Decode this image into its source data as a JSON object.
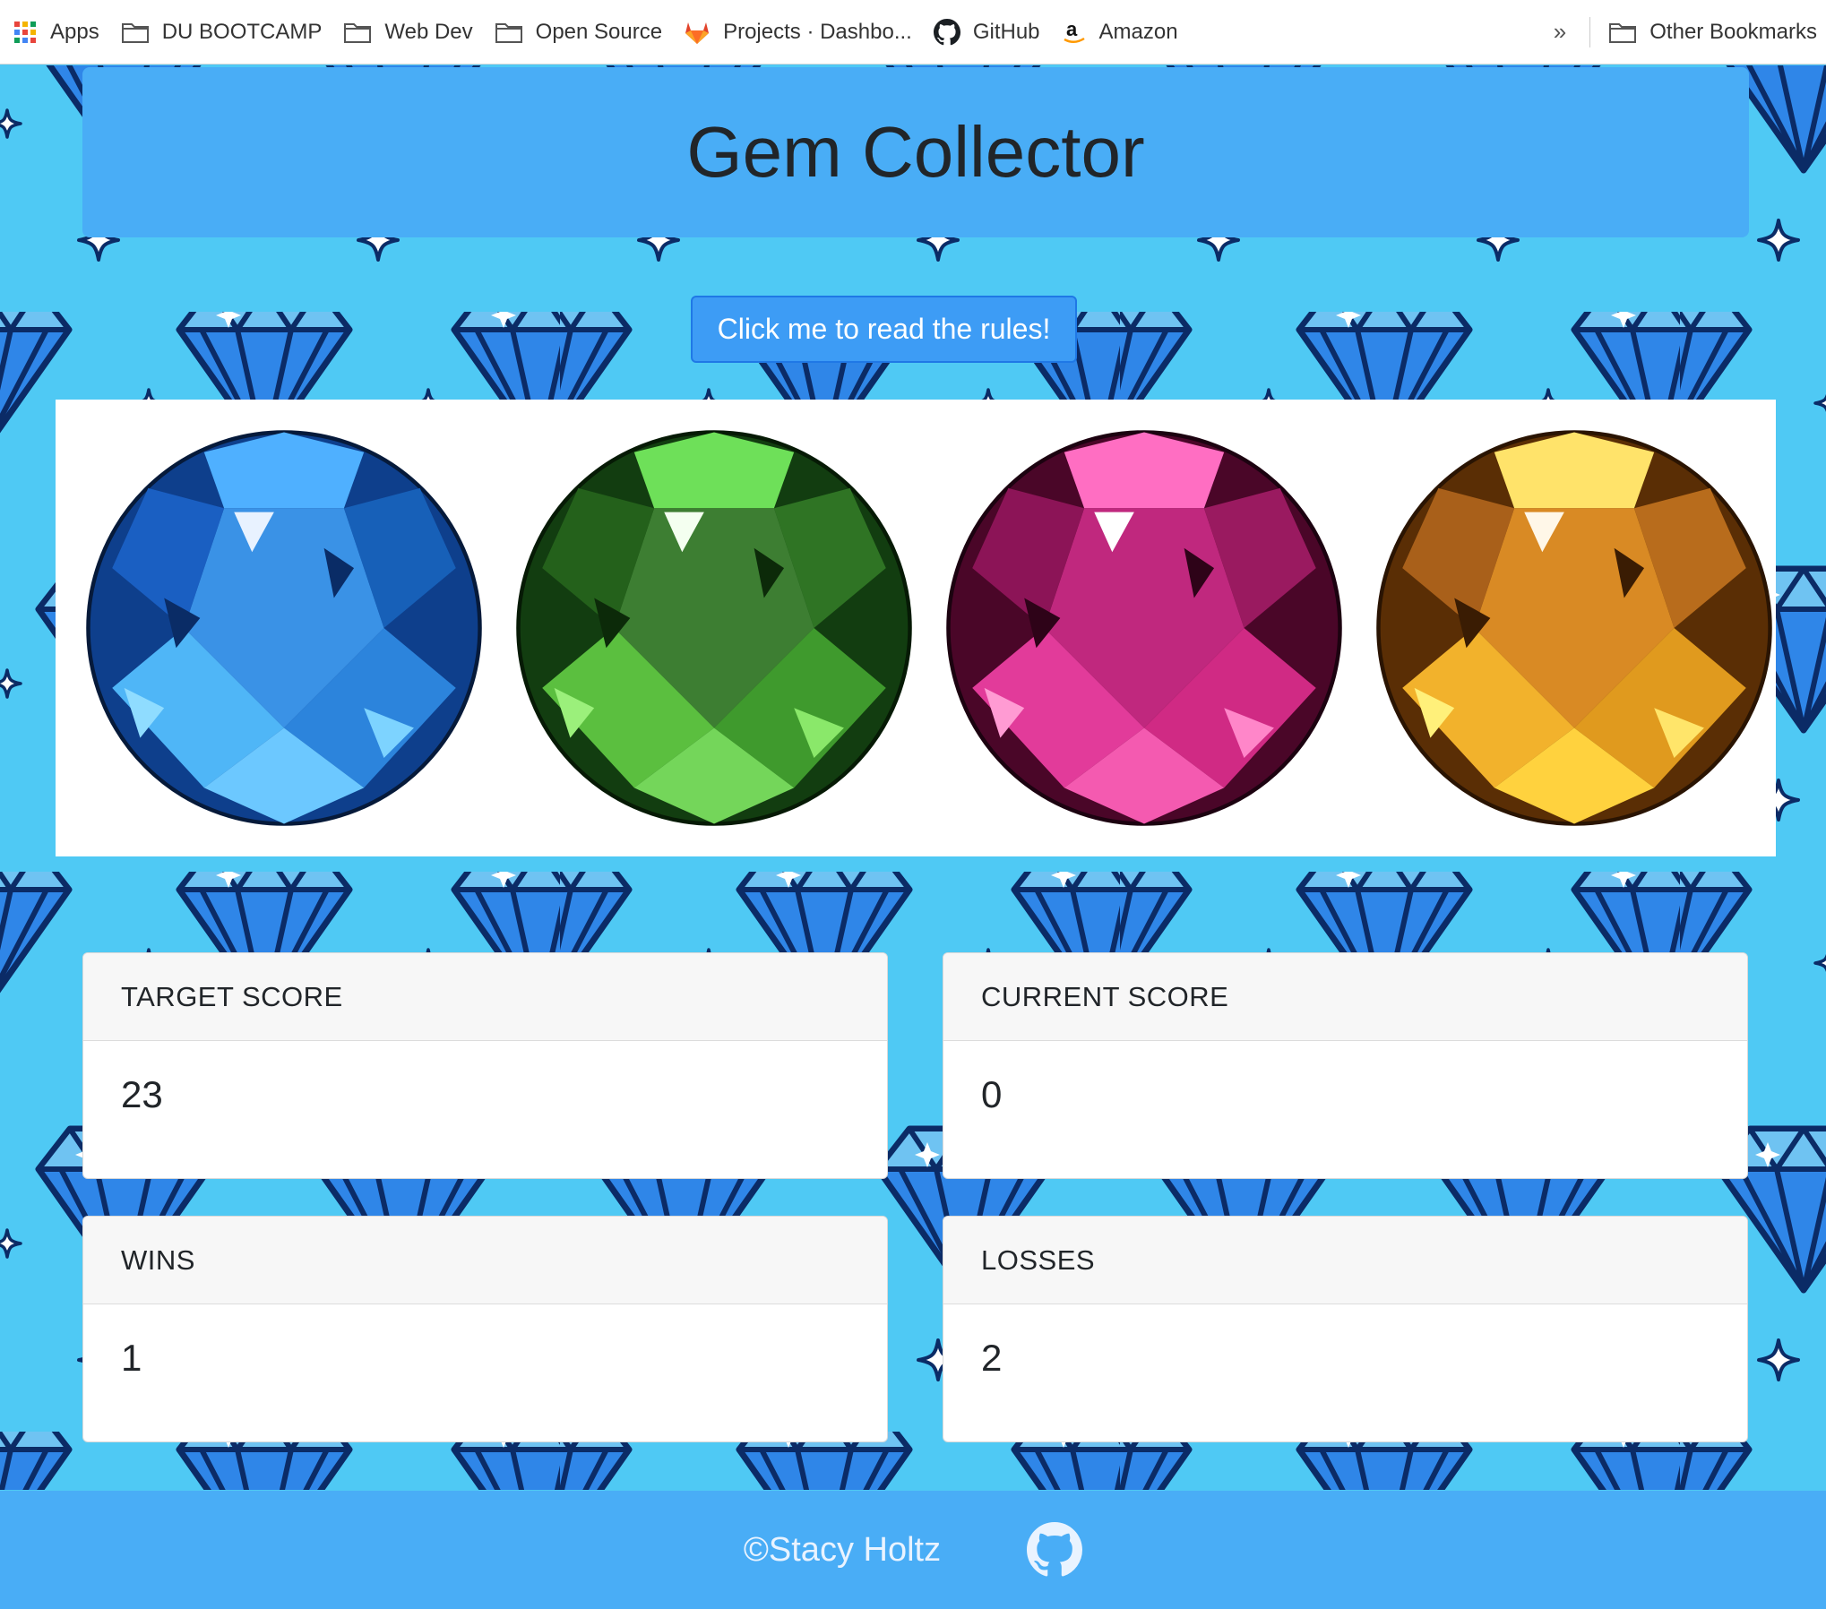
{
  "bookmarks": {
    "items": [
      {
        "label": "Apps",
        "icon": "apps-grid-icon"
      },
      {
        "label": "DU BOOTCAMP",
        "icon": "folder-icon"
      },
      {
        "label": "Web Dev",
        "icon": "folder-icon"
      },
      {
        "label": "Open Source",
        "icon": "folder-icon"
      },
      {
        "label": "Projects · Dashbo...",
        "icon": "gitlab-icon"
      },
      {
        "label": "GitHub",
        "icon": "github-icon"
      },
      {
        "label": "Amazon",
        "icon": "amazon-icon"
      }
    ],
    "more": "»",
    "other": "Other Bookmarks"
  },
  "header": {
    "title": "Gem Collector"
  },
  "rules_button": "Click me to read the rules!",
  "gems": [
    {
      "name": "blue gem",
      "color": "#1f7fe0"
    },
    {
      "name": "green gem",
      "color": "#3f9a2d"
    },
    {
      "name": "pink gem",
      "color": "#d02a84"
    },
    {
      "name": "gold gem",
      "color": "#e09a1e"
    }
  ],
  "scores": {
    "target": {
      "label": "TARGET SCORE",
      "value": "23"
    },
    "current": {
      "label": "CURRENT SCORE",
      "value": "0"
    },
    "wins": {
      "label": "WINS",
      "value": "1"
    },
    "losses": {
      "label": "LOSSES",
      "value": "2"
    }
  },
  "footer": {
    "text": "©Stacy Holtz",
    "icon": "github-icon"
  },
  "colors": {
    "background": "#4fc9f4",
    "header": "#49adf6",
    "button": "#3d9cf5",
    "diamond": "#2f86e8"
  }
}
